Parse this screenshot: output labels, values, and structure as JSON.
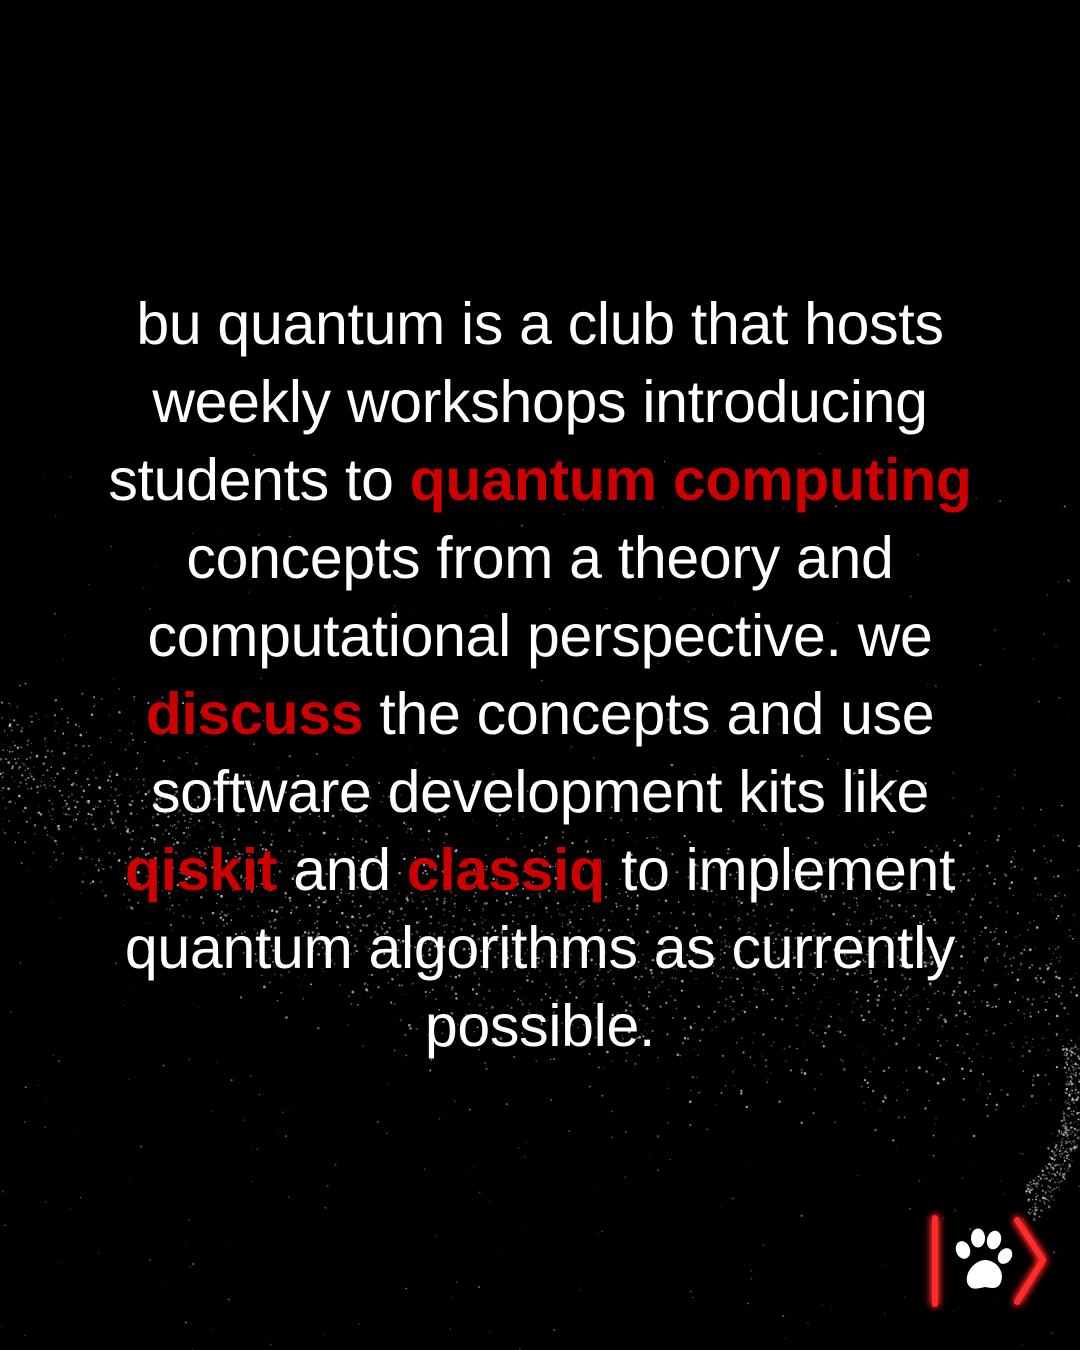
{
  "colors": {
    "background": "#000000",
    "text": "#ffffff",
    "highlight": "#cc0000",
    "logo_glow": "#ff1a1a"
  },
  "lines": [
    [
      {
        "text": "bu quantum is a club that hosts",
        "highlight": false
      }
    ],
    [
      {
        "text": "weekly workshops introducing",
        "highlight": false
      }
    ],
    [
      {
        "text": "students to ",
        "highlight": false
      },
      {
        "text": "quantum computing",
        "highlight": true
      }
    ],
    [
      {
        "text": "concepts from a theory and",
        "highlight": false
      }
    ],
    [
      {
        "text": "computational perspective. we",
        "highlight": false
      }
    ],
    [
      {
        "text": "discuss",
        "highlight": true
      },
      {
        "text": " the concepts and use",
        "highlight": false
      }
    ],
    [
      {
        "text": "software development kits like",
        "highlight": false
      }
    ],
    [
      {
        "text": "qiskit",
        "highlight": true
      },
      {
        "text": " and ",
        "highlight": false
      },
      {
        "text": "classiq",
        "highlight": true
      },
      {
        "text": " to implement",
        "highlight": false
      }
    ],
    [
      {
        "text": "quantum algorithms as currently",
        "highlight": false
      }
    ],
    [
      {
        "text": "possible.",
        "highlight": false
      }
    ]
  ],
  "logo": {
    "icon": "paw-ket-icon"
  }
}
